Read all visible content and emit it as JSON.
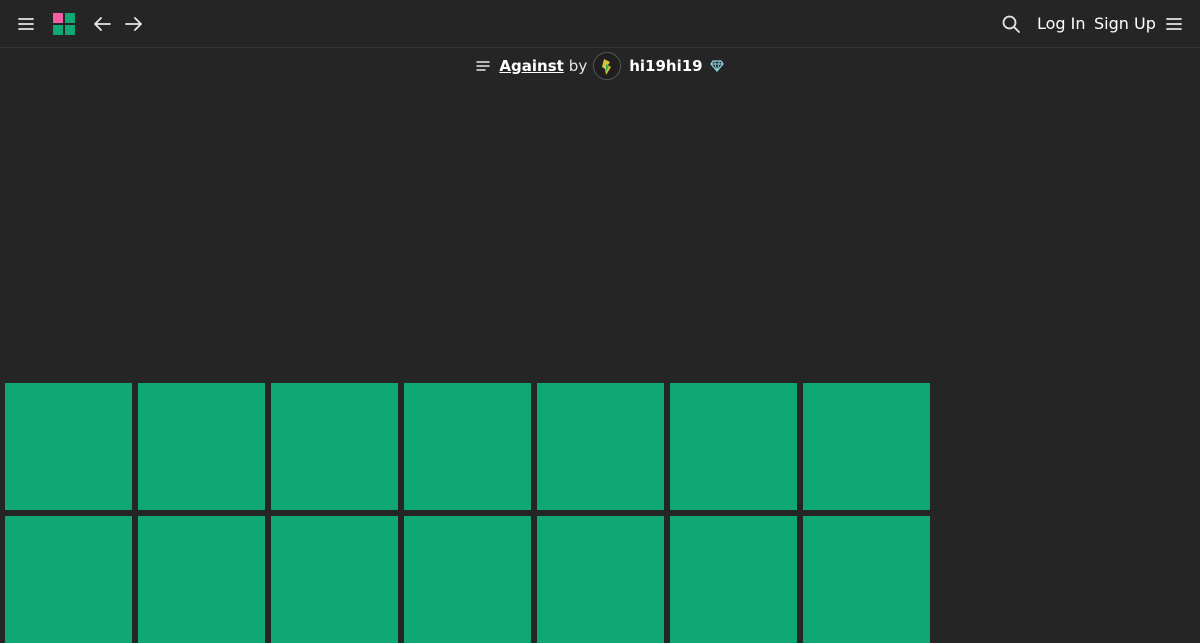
{
  "header": {
    "nav_menu_icon": "hamburger-menu-icon",
    "logo_icon": "tiles-logo-icon",
    "back_icon": "arrow-left-icon",
    "forward_icon": "arrow-right-icon",
    "search_icon": "search-icon",
    "login_label": "Log In",
    "signup_label": "Sign Up",
    "more_menu_icon": "hamburger-menu-icon"
  },
  "project": {
    "list_icon": "list-lines-icon",
    "title": "Against",
    "by_text": "by",
    "author": "hi19hi19",
    "badge_icon": "diamond-icon"
  },
  "tiles": {
    "rows": 2,
    "columns": 7,
    "count": 14
  },
  "colors": {
    "background": "#252525",
    "tile": "#0fa874",
    "logo_pink": "#f45fa3",
    "logo_green": "#0fa874",
    "diamond": "#8fd8e8"
  }
}
